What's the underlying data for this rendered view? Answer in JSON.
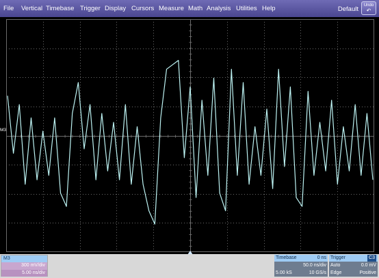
{
  "menu": [
    "File",
    "Vertical",
    "Timebase",
    "Trigger",
    "Display",
    "Cursors",
    "Measure",
    "Math",
    "Analysis",
    "Utilities",
    "Help"
  ],
  "default_label": "Default",
  "undo_label": "Undo",
  "channel_marker": "M3",
  "channel": {
    "name": "M3",
    "vdiv": "300 mV/div",
    "tdiv": "5.00 ns/div"
  },
  "timebase": {
    "title": "Timebase",
    "offset": "0 ns",
    "tdiv": "50.0 ns/div",
    "samples": "5.00 kS",
    "rate": "10 GS/s"
  },
  "trigger": {
    "title": "Trigger",
    "channel": "C3",
    "mode": "Auto",
    "level": "0.0 mV",
    "type": "Edge",
    "slope": "Positive"
  },
  "colors": {
    "trace": "#bdf3f3",
    "grid": "#6b6b6b",
    "menu": "#5a55a3",
    "channel_head": "#9ecbf4"
  },
  "chart_data": {
    "type": "line",
    "grid": {
      "x_divisions": 10,
      "y_divisions": 8
    },
    "series": [
      {
        "values": [
          0.45,
          -0.2,
          0.35,
          -0.55,
          0.2,
          -0.5,
          0.05,
          -0.45,
          0.2,
          -0.65,
          -0.8,
          0.25,
          0.6,
          -0.15,
          0.35,
          -0.5,
          0.25,
          -0.4,
          0.15,
          -0.5,
          0.35,
          -0.55,
          0.1,
          -0.55,
          -0.85,
          -1.0,
          0.2,
          0.75,
          0.8,
          0.85,
          -0.25,
          0.55,
          -0.7,
          0.4,
          -0.45,
          0.65,
          -0.65,
          -0.85,
          0.75,
          -0.45,
          0.6,
          -0.55,
          0.1,
          -0.45,
          0.3,
          -0.6,
          0.75,
          -0.35,
          0.55,
          -0.7,
          -0.8,
          0.5,
          -0.45,
          0.15,
          -0.4,
          0.4,
          -0.55,
          0.1,
          -0.4,
          0.35,
          -0.45,
          0.25,
          -0.5
        ]
      }
    ]
  }
}
